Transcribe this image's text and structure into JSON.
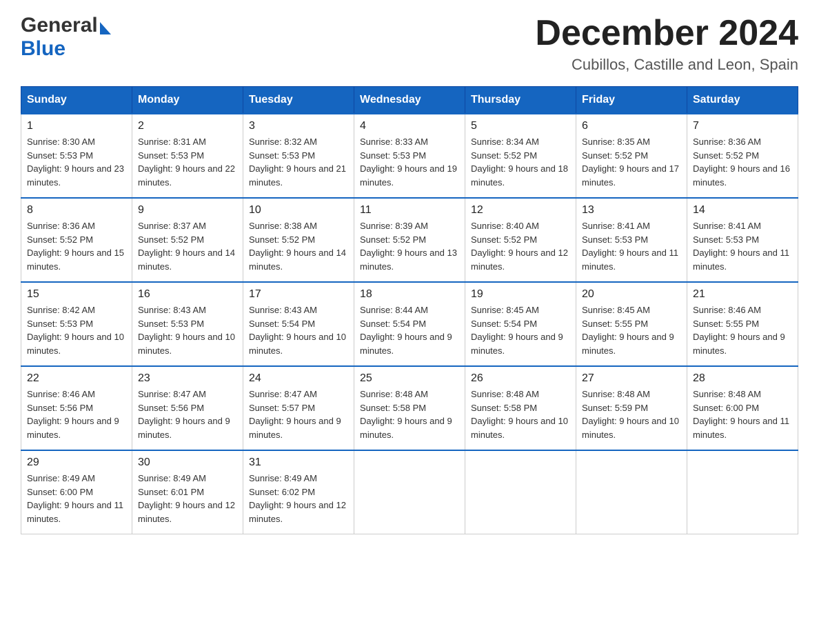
{
  "header": {
    "logo_general": "General",
    "logo_blue": "Blue",
    "main_title": "December 2024",
    "subtitle": "Cubillos, Castille and Leon, Spain"
  },
  "columns": [
    "Sunday",
    "Monday",
    "Tuesday",
    "Wednesday",
    "Thursday",
    "Friday",
    "Saturday"
  ],
  "weeks": [
    [
      {
        "day": "1",
        "sunrise": "Sunrise: 8:30 AM",
        "sunset": "Sunset: 5:53 PM",
        "daylight": "Daylight: 9 hours and 23 minutes."
      },
      {
        "day": "2",
        "sunrise": "Sunrise: 8:31 AM",
        "sunset": "Sunset: 5:53 PM",
        "daylight": "Daylight: 9 hours and 22 minutes."
      },
      {
        "day": "3",
        "sunrise": "Sunrise: 8:32 AM",
        "sunset": "Sunset: 5:53 PM",
        "daylight": "Daylight: 9 hours and 21 minutes."
      },
      {
        "day": "4",
        "sunrise": "Sunrise: 8:33 AM",
        "sunset": "Sunset: 5:53 PM",
        "daylight": "Daylight: 9 hours and 19 minutes."
      },
      {
        "day": "5",
        "sunrise": "Sunrise: 8:34 AM",
        "sunset": "Sunset: 5:52 PM",
        "daylight": "Daylight: 9 hours and 18 minutes."
      },
      {
        "day": "6",
        "sunrise": "Sunrise: 8:35 AM",
        "sunset": "Sunset: 5:52 PM",
        "daylight": "Daylight: 9 hours and 17 minutes."
      },
      {
        "day": "7",
        "sunrise": "Sunrise: 8:36 AM",
        "sunset": "Sunset: 5:52 PM",
        "daylight": "Daylight: 9 hours and 16 minutes."
      }
    ],
    [
      {
        "day": "8",
        "sunrise": "Sunrise: 8:36 AM",
        "sunset": "Sunset: 5:52 PM",
        "daylight": "Daylight: 9 hours and 15 minutes."
      },
      {
        "day": "9",
        "sunrise": "Sunrise: 8:37 AM",
        "sunset": "Sunset: 5:52 PM",
        "daylight": "Daylight: 9 hours and 14 minutes."
      },
      {
        "day": "10",
        "sunrise": "Sunrise: 8:38 AM",
        "sunset": "Sunset: 5:52 PM",
        "daylight": "Daylight: 9 hours and 14 minutes."
      },
      {
        "day": "11",
        "sunrise": "Sunrise: 8:39 AM",
        "sunset": "Sunset: 5:52 PM",
        "daylight": "Daylight: 9 hours and 13 minutes."
      },
      {
        "day": "12",
        "sunrise": "Sunrise: 8:40 AM",
        "sunset": "Sunset: 5:52 PM",
        "daylight": "Daylight: 9 hours and 12 minutes."
      },
      {
        "day": "13",
        "sunrise": "Sunrise: 8:41 AM",
        "sunset": "Sunset: 5:53 PM",
        "daylight": "Daylight: 9 hours and 11 minutes."
      },
      {
        "day": "14",
        "sunrise": "Sunrise: 8:41 AM",
        "sunset": "Sunset: 5:53 PM",
        "daylight": "Daylight: 9 hours and 11 minutes."
      }
    ],
    [
      {
        "day": "15",
        "sunrise": "Sunrise: 8:42 AM",
        "sunset": "Sunset: 5:53 PM",
        "daylight": "Daylight: 9 hours and 10 minutes."
      },
      {
        "day": "16",
        "sunrise": "Sunrise: 8:43 AM",
        "sunset": "Sunset: 5:53 PM",
        "daylight": "Daylight: 9 hours and 10 minutes."
      },
      {
        "day": "17",
        "sunrise": "Sunrise: 8:43 AM",
        "sunset": "Sunset: 5:54 PM",
        "daylight": "Daylight: 9 hours and 10 minutes."
      },
      {
        "day": "18",
        "sunrise": "Sunrise: 8:44 AM",
        "sunset": "Sunset: 5:54 PM",
        "daylight": "Daylight: 9 hours and 9 minutes."
      },
      {
        "day": "19",
        "sunrise": "Sunrise: 8:45 AM",
        "sunset": "Sunset: 5:54 PM",
        "daylight": "Daylight: 9 hours and 9 minutes."
      },
      {
        "day": "20",
        "sunrise": "Sunrise: 8:45 AM",
        "sunset": "Sunset: 5:55 PM",
        "daylight": "Daylight: 9 hours and 9 minutes."
      },
      {
        "day": "21",
        "sunrise": "Sunrise: 8:46 AM",
        "sunset": "Sunset: 5:55 PM",
        "daylight": "Daylight: 9 hours and 9 minutes."
      }
    ],
    [
      {
        "day": "22",
        "sunrise": "Sunrise: 8:46 AM",
        "sunset": "Sunset: 5:56 PM",
        "daylight": "Daylight: 9 hours and 9 minutes."
      },
      {
        "day": "23",
        "sunrise": "Sunrise: 8:47 AM",
        "sunset": "Sunset: 5:56 PM",
        "daylight": "Daylight: 9 hours and 9 minutes."
      },
      {
        "day": "24",
        "sunrise": "Sunrise: 8:47 AM",
        "sunset": "Sunset: 5:57 PM",
        "daylight": "Daylight: 9 hours and 9 minutes."
      },
      {
        "day": "25",
        "sunrise": "Sunrise: 8:48 AM",
        "sunset": "Sunset: 5:58 PM",
        "daylight": "Daylight: 9 hours and 9 minutes."
      },
      {
        "day": "26",
        "sunrise": "Sunrise: 8:48 AM",
        "sunset": "Sunset: 5:58 PM",
        "daylight": "Daylight: 9 hours and 10 minutes."
      },
      {
        "day": "27",
        "sunrise": "Sunrise: 8:48 AM",
        "sunset": "Sunset: 5:59 PM",
        "daylight": "Daylight: 9 hours and 10 minutes."
      },
      {
        "day": "28",
        "sunrise": "Sunrise: 8:48 AM",
        "sunset": "Sunset: 6:00 PM",
        "daylight": "Daylight: 9 hours and 11 minutes."
      }
    ],
    [
      {
        "day": "29",
        "sunrise": "Sunrise: 8:49 AM",
        "sunset": "Sunset: 6:00 PM",
        "daylight": "Daylight: 9 hours and 11 minutes."
      },
      {
        "day": "30",
        "sunrise": "Sunrise: 8:49 AM",
        "sunset": "Sunset: 6:01 PM",
        "daylight": "Daylight: 9 hours and 12 minutes."
      },
      {
        "day": "31",
        "sunrise": "Sunrise: 8:49 AM",
        "sunset": "Sunset: 6:02 PM",
        "daylight": "Daylight: 9 hours and 12 minutes."
      },
      null,
      null,
      null,
      null
    ]
  ]
}
